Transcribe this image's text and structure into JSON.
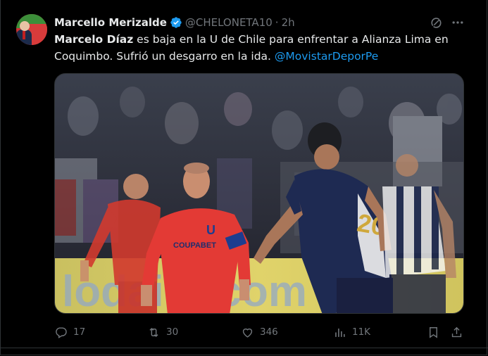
{
  "tweet": {
    "author_name": "Marcello Merizalde",
    "handle": "@CHELONETA10",
    "separator": "·",
    "time": "2h",
    "text_bold": "Marcelo Díaz",
    "text_rest": " es baja en la U de Chile para enfrentar a Alianza Lima en Coquimbo. Sufrió un desgarro en la ida. ",
    "mention": "@MovistarDeporPe"
  },
  "media": {
    "jersey_sponsor": "COUPABET",
    "banner_text": "lodaire.com"
  },
  "actions": {
    "replies": "17",
    "retweets": "30",
    "likes": "346",
    "views": "11K"
  },
  "colors": {
    "background": "#000000",
    "text": "#e7e9ea",
    "muted": "#71767b",
    "link": "#1d9bf0",
    "verified": "#1d9bf0"
  },
  "icons": [
    "verified-badge-icon",
    "grok-icon",
    "more-icon",
    "reply-icon",
    "retweet-icon",
    "like-icon",
    "views-icon",
    "bookmark-icon",
    "share-icon"
  ]
}
